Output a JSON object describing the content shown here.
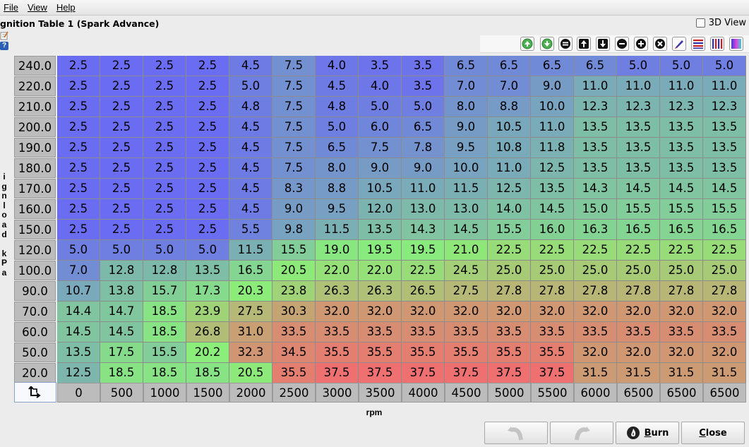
{
  "menu": {
    "file": "File",
    "view": "View",
    "help": "Help"
  },
  "title": "gnition Table 1 (Spark Advance)",
  "view3d": {
    "label": "3D View",
    "checked": false
  },
  "toolbar_icons": [
    "green-up-arrow-icon",
    "green-down-arrow-icon",
    "equals-icon",
    "increment-up-icon",
    "increment-down-icon",
    "minus-icon",
    "plus-icon",
    "clear-icon",
    "pencil-icon",
    "color-lines-icon",
    "color-bars-icon",
    "gradient-icon"
  ],
  "y_axis_label": "ignload kPa",
  "x_axis_label": "rpm",
  "y_bins": [
    "240.0",
    "220.0",
    "210.0",
    "200.0",
    "190.0",
    "180.0",
    "170.0",
    "160.0",
    "150.0",
    "120.0",
    "100.0",
    "90.0",
    "70.0",
    "60.0",
    "50.0",
    "20.0"
  ],
  "x_bins": [
    "0",
    "500",
    "1000",
    "1500",
    "2000",
    "2500",
    "3000",
    "3500",
    "4000",
    "4500",
    "5000",
    "5500",
    "6000",
    "6500",
    "6500",
    "6500"
  ],
  "table": [
    [
      "2.5",
      "2.5",
      "2.5",
      "2.5",
      "4.5",
      "7.5",
      "4.0",
      "3.5",
      "3.5",
      "6.5",
      "6.5",
      "6.5",
      "6.5",
      "5.0",
      "5.0",
      "5.0"
    ],
    [
      "2.5",
      "2.5",
      "2.5",
      "2.5",
      "5.0",
      "7.5",
      "4.5",
      "4.0",
      "3.5",
      "7.0",
      "7.0",
      "9.0",
      "11.0",
      "11.0",
      "11.0",
      "11.0"
    ],
    [
      "2.5",
      "2.5",
      "2.5",
      "2.5",
      "4.8",
      "7.5",
      "4.8",
      "5.0",
      "5.0",
      "8.0",
      "8.8",
      "10.0",
      "12.3",
      "12.3",
      "12.3",
      "12.3"
    ],
    [
      "2.5",
      "2.5",
      "2.5",
      "2.5",
      "4.5",
      "7.5",
      "5.0",
      "6.0",
      "6.5",
      "9.0",
      "10.5",
      "11.0",
      "13.5",
      "13.5",
      "13.5",
      "13.5"
    ],
    [
      "2.5",
      "2.5",
      "2.5",
      "2.5",
      "4.5",
      "7.5",
      "6.5",
      "7.5",
      "7.8",
      "9.5",
      "10.8",
      "11.8",
      "13.5",
      "13.5",
      "13.5",
      "13.5"
    ],
    [
      "2.5",
      "2.5",
      "2.5",
      "2.5",
      "4.5",
      "7.5",
      "8.0",
      "9.0",
      "9.0",
      "10.0",
      "11.0",
      "12.5",
      "13.5",
      "13.5",
      "13.5",
      "13.5"
    ],
    [
      "2.5",
      "2.5",
      "2.5",
      "2.5",
      "4.5",
      "8.3",
      "8.8",
      "10.5",
      "11.0",
      "11.5",
      "12.5",
      "13.5",
      "14.3",
      "14.5",
      "14.5",
      "14.5"
    ],
    [
      "2.5",
      "2.5",
      "2.5",
      "2.5",
      "4.5",
      "9.0",
      "9.5",
      "12.0",
      "13.0",
      "13.0",
      "14.0",
      "14.5",
      "15.0",
      "15.5",
      "15.5",
      "15.5"
    ],
    [
      "2.5",
      "2.5",
      "2.5",
      "2.5",
      "5.5",
      "9.8",
      "11.5",
      "13.5",
      "14.3",
      "14.5",
      "15.5",
      "16.0",
      "16.3",
      "16.5",
      "16.5",
      "16.5"
    ],
    [
      "5.0",
      "5.0",
      "5.0",
      "5.0",
      "11.5",
      "15.5",
      "19.0",
      "19.5",
      "19.5",
      "21.0",
      "22.5",
      "22.5",
      "22.5",
      "22.5",
      "22.5",
      "22.5"
    ],
    [
      "7.0",
      "12.8",
      "12.8",
      "13.5",
      "16.5",
      "20.5",
      "22.0",
      "22.0",
      "22.5",
      "24.5",
      "25.0",
      "25.0",
      "25.0",
      "25.0",
      "25.0",
      "25.0"
    ],
    [
      "10.7",
      "13.8",
      "15.7",
      "17.3",
      "20.3",
      "23.8",
      "26.3",
      "26.3",
      "26.5",
      "27.5",
      "27.8",
      "27.8",
      "27.8",
      "27.8",
      "27.8",
      "27.8"
    ],
    [
      "14.4",
      "14.7",
      "18.5",
      "23.9",
      "27.5",
      "30.3",
      "32.0",
      "32.0",
      "32.0",
      "32.0",
      "32.0",
      "32.0",
      "32.0",
      "32.0",
      "32.0",
      "32.0"
    ],
    [
      "14.5",
      "14.5",
      "18.5",
      "26.8",
      "31.0",
      "33.5",
      "33.5",
      "33.5",
      "33.5",
      "33.5",
      "33.5",
      "33.5",
      "33.5",
      "33.5",
      "33.5",
      "33.5"
    ],
    [
      "13.5",
      "17.5",
      "15.5",
      "20.2",
      "32.3",
      "34.5",
      "35.5",
      "35.5",
      "35.5",
      "35.5",
      "35.5",
      "35.5",
      "32.0",
      "32.0",
      "32.0",
      "32.0"
    ],
    [
      "12.5",
      "18.5",
      "18.5",
      "18.5",
      "20.5",
      "35.5",
      "37.5",
      "37.5",
      "37.5",
      "37.5",
      "37.5",
      "37.5",
      "31.5",
      "31.5",
      "31.5",
      "31.5"
    ]
  ],
  "color_scale": {
    "low": "#6a6cf2",
    "mid": "#8aee7a",
    "high": "#ee7070"
  },
  "buttons": {
    "undo_icon": "undo-icon",
    "redo_icon": "redo-icon",
    "burn": "Burn",
    "burn_icon": "flame-icon",
    "close": "Close"
  }
}
